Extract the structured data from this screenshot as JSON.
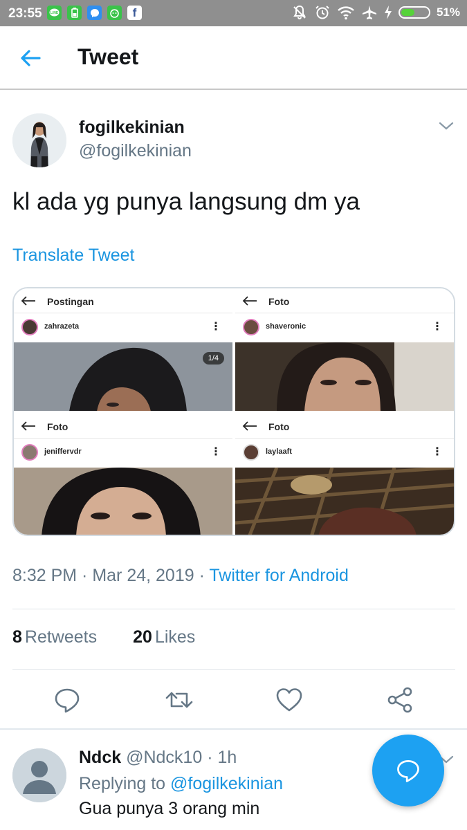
{
  "status_bar": {
    "time": "23:55",
    "battery_percent": "51%",
    "battery_level": 0.51,
    "app_icons": [
      "line-icon",
      "battery-app-icon",
      "messenger-icon",
      "bbm-icon",
      "facebook-icon"
    ],
    "fb_letter": "f"
  },
  "header": {
    "title": "Tweet"
  },
  "tweet": {
    "author_name": "fogilkekinian",
    "author_handle": "@fogilkekinian",
    "text": "kl ada yg punya langsung dm ya",
    "translate_label": "Translate Tweet",
    "time": "8:32 PM · Mar 24, 2019 · ",
    "source": "Twitter for Android",
    "retweets_count": "8",
    "retweets_label": "Retweets",
    "likes_count": "20",
    "likes_label": "Likes"
  },
  "media": [
    {
      "title": "Postingan",
      "username": "zahrazeta",
      "counter": "1/4"
    },
    {
      "title": "Foto",
      "username": "shaveronic"
    },
    {
      "title": "Foto",
      "username": "jeniffervdr"
    },
    {
      "title": "Foto",
      "username": "laylaaft"
    }
  ],
  "reply": {
    "name": "Ndck",
    "handle": "@Ndck10",
    "time": "1h",
    "replying_label": "Replying to ",
    "replying_to": "@fogilkekinian",
    "text": "Gua punya 3 orang min"
  },
  "colors": {
    "accent": "#1da1f2",
    "link": "#1b95e0",
    "secondary_text": "#657786",
    "status_bar": "#8f8f8f"
  }
}
